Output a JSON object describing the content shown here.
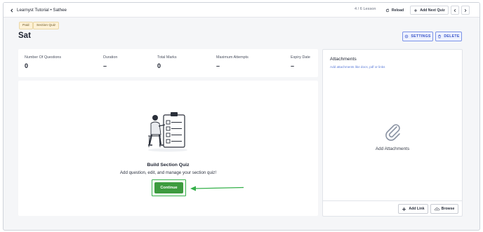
{
  "header": {
    "back_label": "Learnyst Tutorial • Sathee",
    "lesson_count": "4 / 6 Lesson",
    "reload_label": "Reload",
    "add_next_label": "Add Next Quiz"
  },
  "badges": [
    "Paid",
    "Section Quiz"
  ],
  "title": "Sat",
  "actions": {
    "settings_label": "SETTINGS",
    "delete_label": "DELETE"
  },
  "stats": [
    {
      "label": "Number Of Questions",
      "value": "0"
    },
    {
      "label": "Duration",
      "value": "–"
    },
    {
      "label": "Total Marks",
      "value": "0"
    },
    {
      "label": "Maximum Attempts",
      "value": "–"
    },
    {
      "label": "Expiry Date",
      "value": "–"
    }
  ],
  "build": {
    "title": "Build Section Quiz",
    "subtitle": "Add question, edit, and manage your section quiz!",
    "continue_label": "Continue"
  },
  "attachments": {
    "title": "Attachments",
    "subtitle": "Add attachments like docs, pdf or links",
    "empty_label": "Add Attachments",
    "add_link_label": "Add Link",
    "browse_label": "Browse"
  },
  "colors": {
    "accent_blue": "#3a55c8",
    "continue_green": "#3d9b3f",
    "highlight_green": "#35b04a",
    "badge_bg": "#fdf1d6"
  }
}
